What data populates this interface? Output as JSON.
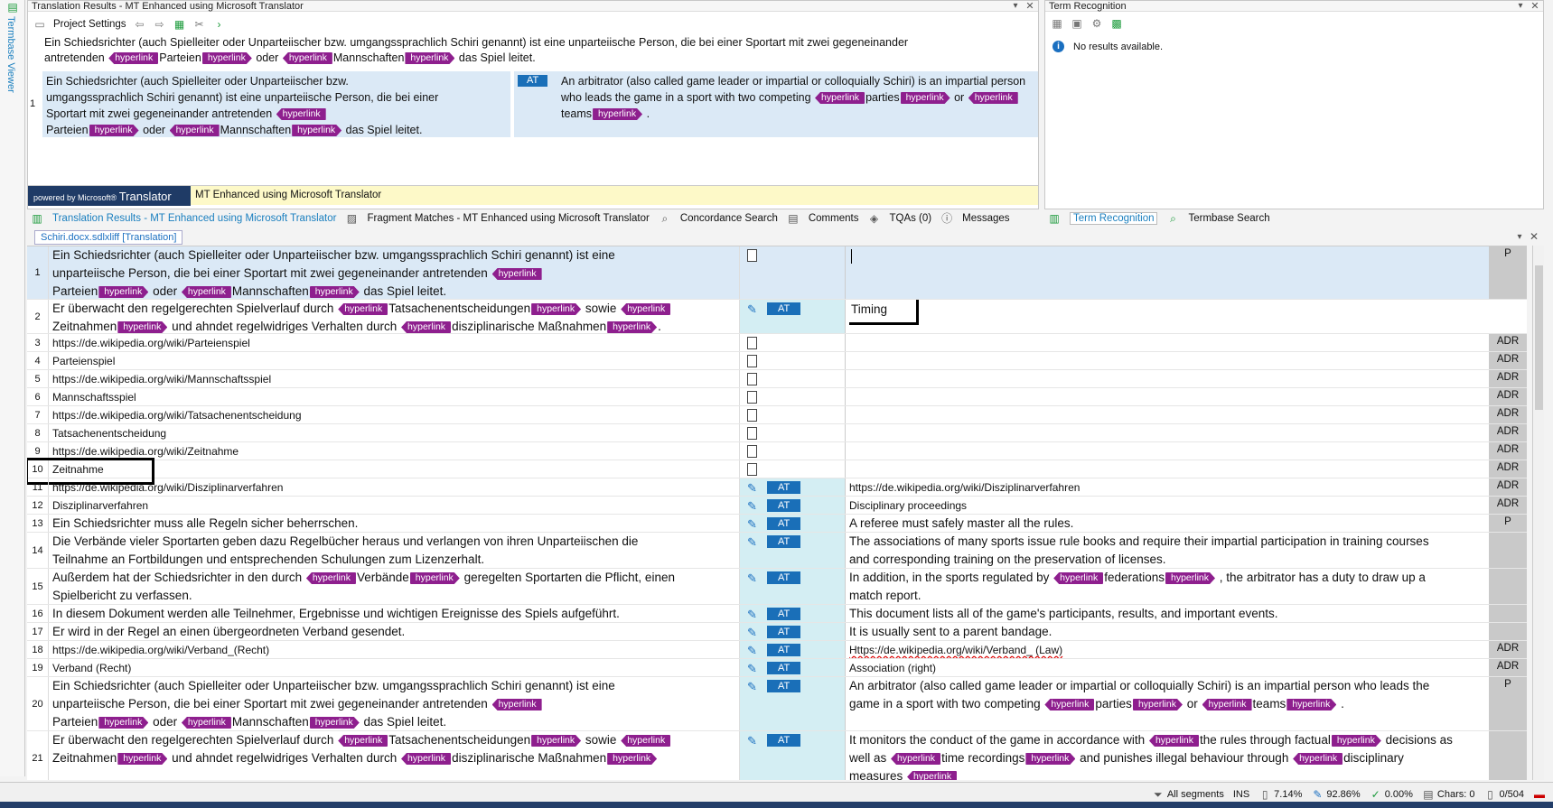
{
  "left_strip": {
    "label": "Termbase Viewer"
  },
  "translation_results": {
    "title": "Translation Results - MT Enhanced using Microsoft Translator",
    "toolbar": {
      "project_settings": "Project Settings"
    },
    "source_line1": "Ein Schiedsrichter (auch Spielleiter oder Unparteiischer bzw. umgangssprachlich Schiri genannt) ist eine unparteiische Person, die bei einer Sportart mit zwei gegeneinander",
    "source_line2": {
      "a": "antretenden",
      "b": "Parteien",
      "c": "oder",
      "d": "Mannschaften",
      "e": "das Spiel leitet."
    },
    "row_number": "1",
    "row_source": {
      "l1": "Ein Schiedsrichter (auch Spielleiter oder Unparteiischer bzw.",
      "l2": "umgangssprachlich Schiri genannt) ist eine unparteiische Person, die bei einer",
      "l3": "Sportart mit zwei gegeneinander antretenden",
      "l4a": "Parteien",
      "l4b": "oder",
      "l4c": "Mannschaften",
      "l4d": "das Spiel leitet."
    },
    "row_badge": "AT",
    "row_target": {
      "l1": "An arbitrator (also called game leader or impartial or colloquially Schiri) is an impartial person",
      "l2a": "who leads the game in a sport with two competing",
      "l2b": "parties",
      "l2c": "or",
      "l3a": "teams",
      "l3b": "."
    },
    "tag_label": "hyperlink",
    "mt_logo_small": "powered by",
    "mt_logo_brand": "Microsoft®",
    "mt_logo_name": "Translator",
    "mt_label": "MT Enhanced using Microsoft Translator"
  },
  "tabs_left": [
    "Translation Results - MT Enhanced using Microsoft Translator",
    "Fragment Matches - MT Enhanced using Microsoft Translator",
    "Concordance Search",
    "Comments",
    "TQAs (0)",
    "Messages"
  ],
  "term_recognition": {
    "title": "Term Recognition",
    "message": "No results available."
  },
  "tabs_right": [
    "Term Recognition",
    "Termbase Search"
  ],
  "document_tab": "Schiri.docx.sdlxliff [Translation]",
  "segments": {
    "s1": {
      "n": "1",
      "l1": "Ein Schiedsrichter (auch Spielleiter oder Unparteiischer bzw. umgangssprachlich Schiri genannt) ist eine",
      "l2": "unparteiische Person, die bei einer Sportart mit zwei gegeneinander antretenden",
      "l3a": "Parteien",
      "l3b": "oder",
      "l3c": "Mannschaften",
      "l3d": "das Spiel leitet.",
      "code": "P"
    },
    "s2": {
      "n": "2",
      "l1a": "Er überwacht den regelgerechten Spielverlauf durch",
      "l1b": "Tatsachenentscheidungen",
      "l1c": "sowie",
      "l2a": "Zeitnahmen",
      "l2b": "und ahndet regelwidriges Verhalten durch",
      "l2c": "disziplinarische Maßnahmen",
      "l2d": ".",
      "badge": "AT",
      "target": "Timing"
    },
    "s3": {
      "n": "3",
      "src": "https://de.wikipedia.org/wiki/Parteienspiel",
      "code": "ADR"
    },
    "s4": {
      "n": "4",
      "src": "Parteienspiel",
      "code": "ADR"
    },
    "s5": {
      "n": "5",
      "src": "https://de.wikipedia.org/wiki/Mannschaftsspiel",
      "code": "ADR"
    },
    "s6": {
      "n": "6",
      "src": "Mannschaftsspiel",
      "code": "ADR"
    },
    "s7": {
      "n": "7",
      "src": "https://de.wikipedia.org/wiki/Tatsachenentscheidung",
      "code": "ADR"
    },
    "s8": {
      "n": "8",
      "src": "Tatsachenentscheidung",
      "code": "ADR"
    },
    "s9": {
      "n": "9",
      "src": "https://de.wikipedia.org/wiki/Zeitnahme",
      "code": "ADR"
    },
    "s10": {
      "n": "10",
      "src": "Zeitnahme",
      "code": "ADR"
    },
    "s11": {
      "n": "11",
      "src": "https://de.wikipedia.org/wiki/Disziplinarverfahren",
      "badge": "AT",
      "tgt": "https://de.wikipedia.org/wiki/Disziplinarverfahren",
      "code": "ADR"
    },
    "s12": {
      "n": "12",
      "src": "Disziplinarverfahren",
      "badge": "AT",
      "tgt": "Disciplinary proceedings",
      "code": "ADR"
    },
    "s13": {
      "n": "13",
      "src": "Ein Schiedsrichter muss alle Regeln sicher beherrschen.",
      "badge": "AT",
      "tgt": "A referee must safely master all the rules.",
      "code": "P"
    },
    "s14": {
      "n": "14",
      "src1": "Die Verbände vieler Sportarten geben dazu Regelbücher heraus und verlangen von ihren Unparteiischen die",
      "src2": "Teilnahme an Fortbildungen und entsprechenden Schulungen zum Lizenzerhalt.",
      "badge": "AT",
      "tgt1": "The associations of many sports issue rule books and require their impartial participation in training courses",
      "tgt2": "and corresponding training on the preservation of licenses."
    },
    "s15": {
      "n": "15",
      "src1a": "Außerdem hat der Schiedsrichter in den durch",
      "src1b": "Verbände",
      "src1c": "geregelten Sportarten die Pflicht, einen",
      "src2": "Spielbericht zu verfassen.",
      "badge": "AT",
      "tgt1a": "In addition, in the sports regulated by",
      "tgt1b": "federations",
      "tgt1c": ", the arbitrator has a duty to draw up a",
      "tgt2": "match report."
    },
    "s16": {
      "n": "16",
      "src": "In diesem Dokument werden alle Teilnehmer, Ergebnisse und wichtigen Ereignisse des Spiels aufgeführt.",
      "badge": "AT",
      "tgt": "This document lists all of the game's participants, results, and important events."
    },
    "s17": {
      "n": "17",
      "src": "Er wird in der Regel an einen übergeordneten Verband gesendet.",
      "badge": "AT",
      "tgt": "It is usually sent to a parent bandage."
    },
    "s18": {
      "n": "18",
      "src": "https://de.wikipedia.org/wiki/Verband_(Recht)",
      "badge": "AT",
      "tgt": "Https://de.wikipedia.org/wiki/Verband_ (Law)",
      "code": "ADR"
    },
    "s19": {
      "n": "19",
      "src": "Verband (Recht)",
      "badge": "AT",
      "tgt": "Association (right)",
      "code": "ADR"
    },
    "s20": {
      "n": "20",
      "src1": "Ein Schiedsrichter (auch Spielleiter oder Unparteiischer bzw. umgangssprachlich Schiri genannt) ist eine",
      "src2": "unparteiische Person, die bei einer Sportart mit zwei gegeneinander antretenden",
      "src3a": "Parteien",
      "src3b": "oder",
      "src3c": "Mannschaften",
      "src3d": "das Spiel leitet.",
      "badge": "AT",
      "tgt1": "An arbitrator (also called game leader or impartial or colloquially Schiri) is an impartial person who leads the",
      "tgt2a": "game in a sport with two competing",
      "tgt2b": "parties",
      "tgt2c": "or",
      "tgt2d": "teams",
      "tgt2e": ".",
      "code": "P"
    },
    "s21": {
      "n": "21",
      "src1a": "Er überwacht den regelgerechten Spielverlauf durch",
      "src1b": "Tatsachenentscheidungen",
      "src1c": "sowie",
      "src2a": "Zeitnahmen",
      "src2b": "und ahndet regelwidriges Verhalten durch",
      "src2c": "disziplinarische Maßnahmen",
      "badge": "AT",
      "tgt1a": "It monitors the conduct of the game in accordance with",
      "tgt1b": "the rules through factual",
      "tgt1c": "decisions as",
      "tgt2a": "well as",
      "tgt2b": "time recordings",
      "tgt2c": "and punishes illegal behaviour through",
      "tgt2d": "disciplinary",
      "tgt3": "measures"
    }
  },
  "status_bar": {
    "filter": "All segments",
    "mode": "INS",
    "pct1": "7.14%",
    "pct2": "92.86%",
    "pct3": "0.00%",
    "chars": "Chars: 0",
    "count": "0/504"
  },
  "colors": {
    "tag": "#8e1f8e",
    "badge": "#1a6fb8",
    "selected_row": "#dbe9f6",
    "status_mt": "#d4eef3",
    "accent": "#1a7fbf"
  }
}
